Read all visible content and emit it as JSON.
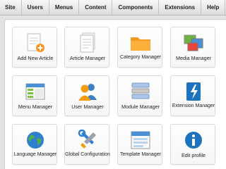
{
  "menubar": {
    "items": [
      "Site",
      "Users",
      "Menus",
      "Content",
      "Components",
      "Extensions",
      "Help"
    ]
  },
  "quickicons": [
    {
      "label": "Add New Article",
      "icon": "add-article-icon"
    },
    {
      "label": "Article Manager",
      "icon": "article-icon"
    },
    {
      "label": "Category Manager",
      "icon": "folder-icon"
    },
    {
      "label": "Media Manager",
      "icon": "media-icon"
    },
    {
      "label": "Menu Manager",
      "icon": "menu-icon"
    },
    {
      "label": "User Manager",
      "icon": "users-icon"
    },
    {
      "label": "Module Manager",
      "icon": "module-icon"
    },
    {
      "label": "Extension Manager",
      "icon": "extension-icon"
    },
    {
      "label": "Language Manager",
      "icon": "globe-icon"
    },
    {
      "label": "Global Configuration",
      "icon": "tools-icon"
    },
    {
      "label": "Template Manager",
      "icon": "template-icon"
    },
    {
      "label": "Edit profile",
      "icon": "info-icon"
    }
  ]
}
